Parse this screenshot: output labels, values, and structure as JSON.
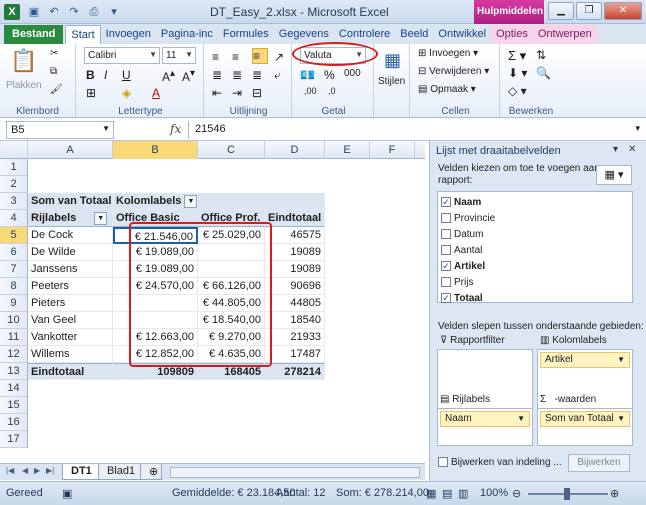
{
  "window": {
    "title": "DT_Easy_2.xlsx - Microsoft Excel",
    "context_tab_title": "Hulpmiddelen vo..."
  },
  "tabs": [
    "Bestand",
    "Start",
    "Invoegen",
    "Pagina-inc",
    "Formules",
    "Gegevens",
    "Controlere",
    "Beeld",
    "Ontwikkel",
    "Opties",
    "Ontwerpen"
  ],
  "ribbon": {
    "paste_label": "Plakken",
    "clipboard_label": "Klembord",
    "font_name": "Calibri",
    "font_size": "11",
    "font_label": "Lettertype",
    "align_label": "Uitlijning",
    "number_format": "Valuta",
    "number_label": "Getal",
    "styles_label": "Stijlen",
    "insert_label": "Invoegen",
    "delete_label": "Verwijderen",
    "format_label": "Opmaak",
    "cells_label": "Cellen",
    "edit_label": "Bewerken"
  },
  "formula_bar": {
    "name_box": "B5",
    "fx": "fx",
    "formula": "21546"
  },
  "columns": [
    "A",
    "B",
    "C",
    "D",
    "E",
    "F"
  ],
  "rows": [
    "1",
    "2",
    "3",
    "4",
    "5",
    "6",
    "7",
    "8",
    "9",
    "10",
    "11",
    "12",
    "13",
    "14",
    "15",
    "16",
    "17"
  ],
  "pivot": {
    "corner_label": "Som van Totaal",
    "col_labels": "Kolomlabels",
    "row_labels": "Rijlabels",
    "headers": [
      "Office Basic",
      "Office Prof.",
      "Eindtotaal"
    ],
    "data": [
      {
        "name": "De Cock",
        "basic": "€ 21.546,00",
        "prof": "€ 25.029,00",
        "total": "46575"
      },
      {
        "name": "De Wilde",
        "basic": "€ 19.089,00",
        "prof": "",
        "total": "19089"
      },
      {
        "name": "Janssens",
        "basic": "€ 19.089,00",
        "prof": "",
        "total": "19089"
      },
      {
        "name": "Peeters",
        "basic": "€ 24.570,00",
        "prof": "€ 66.126,00",
        "total": "90696"
      },
      {
        "name": "Pieters",
        "basic": "",
        "prof": "€ 44.805,00",
        "total": "44805"
      },
      {
        "name": "Van Geel",
        "basic": "",
        "prof": "€ 18.540,00",
        "total": "18540"
      },
      {
        "name": "Vankotter",
        "basic": "€ 12.663,00",
        "prof": "€ 9.270,00",
        "total": "21933"
      },
      {
        "name": "Willems",
        "basic": "€ 12.852,00",
        "prof": "€ 4.635,00",
        "total": "17487"
      }
    ],
    "total_row": {
      "name": "Eindtotaal",
      "basic": "109809",
      "prof": "168405",
      "total": "278214"
    }
  },
  "sheets": [
    "DT1",
    "Blad1"
  ],
  "status": {
    "ready": "Gereed",
    "average": "Gemiddelde: € 23.184,50",
    "count": "Aantal: 12",
    "sum": "Som: € 278.214,00",
    "zoom": "100%"
  },
  "pane": {
    "title": "Lijst met draaitabelvelden",
    "choose_text_1": "Velden kiezen om toe te voegen aan",
    "choose_text_2": "rapport:",
    "fields": [
      {
        "name": "Naam",
        "checked": true
      },
      {
        "name": "Provincie",
        "checked": false
      },
      {
        "name": "Datum",
        "checked": false
      },
      {
        "name": "Aantal",
        "checked": false
      },
      {
        "name": "Artikel",
        "checked": true
      },
      {
        "name": "Prijs",
        "checked": false
      },
      {
        "name": "Totaal",
        "checked": true
      }
    ],
    "drag_text": "Velden slepen tussen onderstaande gebieden:",
    "report_filter": "Rapportfilter",
    "column_labels": "Kolomlabels",
    "column_item": "Artikel",
    "row_labels": "Rijlabels",
    "row_item": "Naam",
    "values_label": "-waarden",
    "values_item": "Som van Totaal",
    "defer_update": "Bijwerken van indeling ...",
    "update_button": "Bijwerken"
  }
}
